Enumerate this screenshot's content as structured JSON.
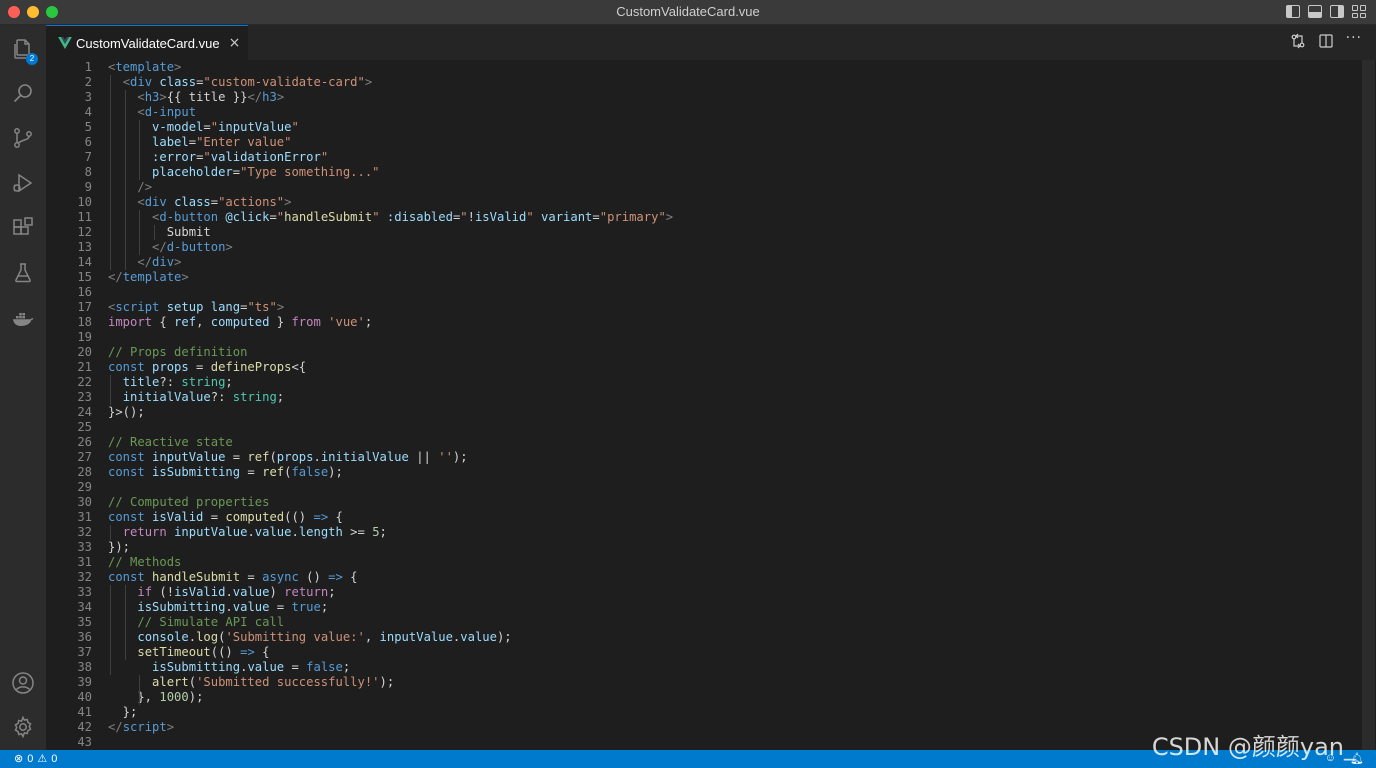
{
  "window": {
    "title": "CustomValidateCard.vue"
  },
  "activity_bar": {
    "explorer_badge": "2",
    "items": [
      "files-icon",
      "search-icon",
      "source-control-icon",
      "run-debug-icon",
      "extensions-icon",
      "testing-icon",
      "docker-icon"
    ],
    "bottom_items": [
      "account-icon",
      "settings-gear-icon"
    ]
  },
  "tab": {
    "label": "CustomValidateCard.vue",
    "close": "×"
  },
  "editor_actions": {
    "more": "···"
  },
  "code": {
    "lines": [
      {
        "n": "1",
        "html": "<span class='tg'>&lt;</span><span class='tn'>template</span><span class='tg'>&gt;</span>"
      },
      {
        "n": "2",
        "html": "  <span class='tg'>&lt;</span><span class='tn'>div</span> <span class='at'>class</span>=<span class='sv'>\"custom-validate-card\"</span><span class='tg'>&gt;</span>"
      },
      {
        "n": "3",
        "html": "    <span class='tg'>&lt;</span><span class='tn'>h3</span><span class='tg'>&gt;</span>{{ title }}<span class='tg'>&lt;/</span><span class='tn'>h3</span><span class='tg'>&gt;</span>"
      },
      {
        "n": "4",
        "html": "    <span class='tg'>&lt;</span><span class='tn'>d-input</span>"
      },
      {
        "n": "5",
        "html": "      <span class='at'>v-model</span>=<span class='sv'>\"</span><span class='vr'>inputValue</span><span class='sv'>\"</span>"
      },
      {
        "n": "6",
        "html": "      <span class='at'>label</span>=<span class='sv'>\"Enter value\"</span>"
      },
      {
        "n": "7",
        "html": "      <span class='at'>:error</span>=<span class='sv'>\"</span><span class='vr'>validationError</span><span class='sv'>\"</span>"
      },
      {
        "n": "8",
        "html": "      <span class='at'>placeholder</span>=<span class='sv'>\"Type something...\"</span>"
      },
      {
        "n": "9",
        "html": "    <span class='tg'>/&gt;</span>"
      },
      {
        "n": "10",
        "html": "    <span class='tg'>&lt;</span><span class='tn'>div</span> <span class='at'>class</span>=<span class='sv'>\"actions\"</span><span class='tg'>&gt;</span>"
      },
      {
        "n": "11",
        "html": "      <span class='tg'>&lt;</span><span class='tn'>d-button</span> <span class='at'>@click</span>=<span class='sv'>\"</span><span class='fn'>handleSubmit</span><span class='sv'>\"</span> <span class='at'>:disabled</span>=<span class='sv'>\"</span>!<span class='vr'>isValid</span><span class='sv'>\"</span> <span class='at'>variant</span>=<span class='sv'>\"primary\"</span><span class='tg'>&gt;</span>"
      },
      {
        "n": "12",
        "html": "        Submit"
      },
      {
        "n": "13",
        "html": "      <span class='tg'>&lt;/</span><span class='tn'>d-button</span><span class='tg'>&gt;</span>"
      },
      {
        "n": "14",
        "html": "    <span class='tg'>&lt;/</span><span class='tn'>div</span><span class='tg'>&gt;</span>"
      },
      {
        "n": "15",
        "html": "<span class='tg'>&lt;/</span><span class='tn'>template</span><span class='tg'>&gt;</span>"
      },
      {
        "n": "16",
        "html": ""
      },
      {
        "n": "17",
        "html": "<span class='tg'>&lt;</span><span class='tn'>script</span> <span class='at'>setup</span> <span class='at'>lang</span>=<span class='sv'>\"ts\"</span><span class='tg'>&gt;</span>"
      },
      {
        "n": "18",
        "html": "<span class='ct'>import</span> { <span class='vr'>ref</span>, <span class='vr'>computed</span> } <span class='ct'>from</span> <span class='sv'>'vue'</span>;"
      },
      {
        "n": "19",
        "html": ""
      },
      {
        "n": "20",
        "html": "<span class='cm'>// Props definition</span>"
      },
      {
        "n": "21",
        "html": "<span class='kw'>const</span> <span class='vr'>props</span> = <span class='fn'>defineProps</span>&lt;{"
      },
      {
        "n": "22",
        "html": "  <span class='vr'>title</span>?: <span class='ty'>string</span>;"
      },
      {
        "n": "23",
        "html": "  <span class='vr'>initialValue</span>?: <span class='ty'>string</span>;"
      },
      {
        "n": "24",
        "html": "}&gt;();"
      },
      {
        "n": "25",
        "html": ""
      },
      {
        "n": "26",
        "html": "<span class='cm'>// Reactive state</span>"
      },
      {
        "n": "27",
        "html": "<span class='kw'>const</span> <span class='vr'>inputValue</span> = <span class='fn'>ref</span>(<span class='vr'>props</span>.<span class='vr'>initialValue</span> || <span class='sv'>''</span>);"
      },
      {
        "n": "28",
        "html": "<span class='kw'>const</span> <span class='vr'>isSubmitting</span> = <span class='fn'>ref</span>(<span class='kw'>false</span>);"
      },
      {
        "n": "29",
        "html": ""
      },
      {
        "n": "30",
        "html": "<span class='cm'>// Computed properties</span>"
      },
      {
        "n": "31",
        "html": "<span class='kw'>const</span> <span class='vr'>isValid</span> = <span class='fn'>computed</span>(() <span class='kw'>=&gt;</span> {"
      },
      {
        "n": "32",
        "html": "  <span class='ct'>return</span> <span class='vr'>inputValue</span>.<span class='vr'>value</span>.<span class='vr'>length</span> &gt;= <span class='nm'>5</span>;"
      },
      {
        "n": "33",
        "html": "});"
      },
      {
        "n": "31",
        "html": "<span class='cm'>// Methods</span>"
      },
      {
        "n": "32",
        "html": "<span class='kw'>const</span> <span class='fn'>handleSubmit</span> = <span class='kw'>async</span> () <span class='kw'>=&gt;</span> {"
      },
      {
        "n": "33",
        "html": "    <span class='ct'>if</span> (!<span class='vr'>isValid</span>.<span class='vr'>value</span>) <span class='ct'>return</span>;"
      },
      {
        "n": "34",
        "html": "    <span class='vr'>isSubmitting</span>.<span class='vr'>value</span> = <span class='kw'>true</span>;"
      },
      {
        "n": "35",
        "html": "    <span class='cm'>// Simulate API call</span>"
      },
      {
        "n": "36",
        "html": "    <span class='vr'>console</span>.<span class='fn'>log</span>(<span class='sv'>'Submitting value:'</span>, <span class='vr'>inputValue</span>.<span class='vr'>value</span>);"
      },
      {
        "n": "37",
        "html": "    <span class='fn'>setTimeout</span>(() <span class='kw'>=&gt;</span> {"
      },
      {
        "n": "38",
        "html": "      <span class='vr'>isSubmitting</span>.<span class='vr'>value</span> = <span class='kw'>false</span>;"
      },
      {
        "n": "39",
        "html": "      <span class='fn'>alert</span>(<span class='sv'>'Submitted successfully!'</span>);"
      },
      {
        "n": "40",
        "html": "    }, <span class='nm'>1000</span>);"
      },
      {
        "n": "41",
        "html": "  };"
      },
      {
        "n": "42",
        "html": "<span class='tg'>&lt;/</span><span class='tn'>script</span><span class='tg'>&gt;</span>"
      },
      {
        "n": "43",
        "html": ""
      }
    ]
  },
  "status_bar": {
    "errors": "0",
    "warnings": "0"
  },
  "watermark": "CSDN @颜颜yan_",
  "colors": {
    "accent": "#007acc",
    "tab_border": "#0078d4",
    "vue_green": "#41b883"
  }
}
